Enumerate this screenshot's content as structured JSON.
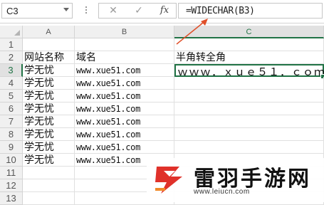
{
  "formula_bar": {
    "name_box": "C3",
    "cancel_glyph": "✕",
    "enter_glyph": "✓",
    "fx_label": "fx",
    "formula": "=WIDECHAR(B3)"
  },
  "columns": [
    "A",
    "B",
    "C"
  ],
  "selected_column": "C",
  "rows": [
    {
      "num": "1",
      "a": "",
      "b": "",
      "c": ""
    },
    {
      "num": "2",
      "a": "网站名称",
      "b": "域名",
      "c": "半角转全角"
    },
    {
      "num": "3",
      "a": "学无忧",
      "b": "www.xue51.com",
      "c": "ｗｗｗ．ｘｕｅ５１．ｃｏｍ"
    },
    {
      "num": "4",
      "a": "学无忧",
      "b": "www.xue51.com",
      "c": ""
    },
    {
      "num": "5",
      "a": "学无忧",
      "b": "www.xue51.com",
      "c": ""
    },
    {
      "num": "6",
      "a": "学无忧",
      "b": "www.xue51.com",
      "c": ""
    },
    {
      "num": "7",
      "a": "学无忧",
      "b": "www.xue51.com",
      "c": ""
    },
    {
      "num": "8",
      "a": "学无忧",
      "b": "www.xue51.com",
      "c": ""
    },
    {
      "num": "9",
      "a": "学无忧",
      "b": "www.xue51.com",
      "c": ""
    },
    {
      "num": "10",
      "a": "学无忧",
      "b": "www.xue51.com",
      "c": ""
    },
    {
      "num": "11",
      "a": "",
      "b": "",
      "c": ""
    },
    {
      "num": "12",
      "a": "",
      "b": "",
      "c": ""
    },
    {
      "num": "13",
      "a": "",
      "b": "",
      "c": ""
    }
  ],
  "active_cell": "C3",
  "colors": {
    "accent": "#217346",
    "annotation": "#e0502a"
  },
  "watermark": {
    "title": "雷羽手游网",
    "url": "www.leiucn.com",
    "icon": "lightning-logo-icon"
  }
}
